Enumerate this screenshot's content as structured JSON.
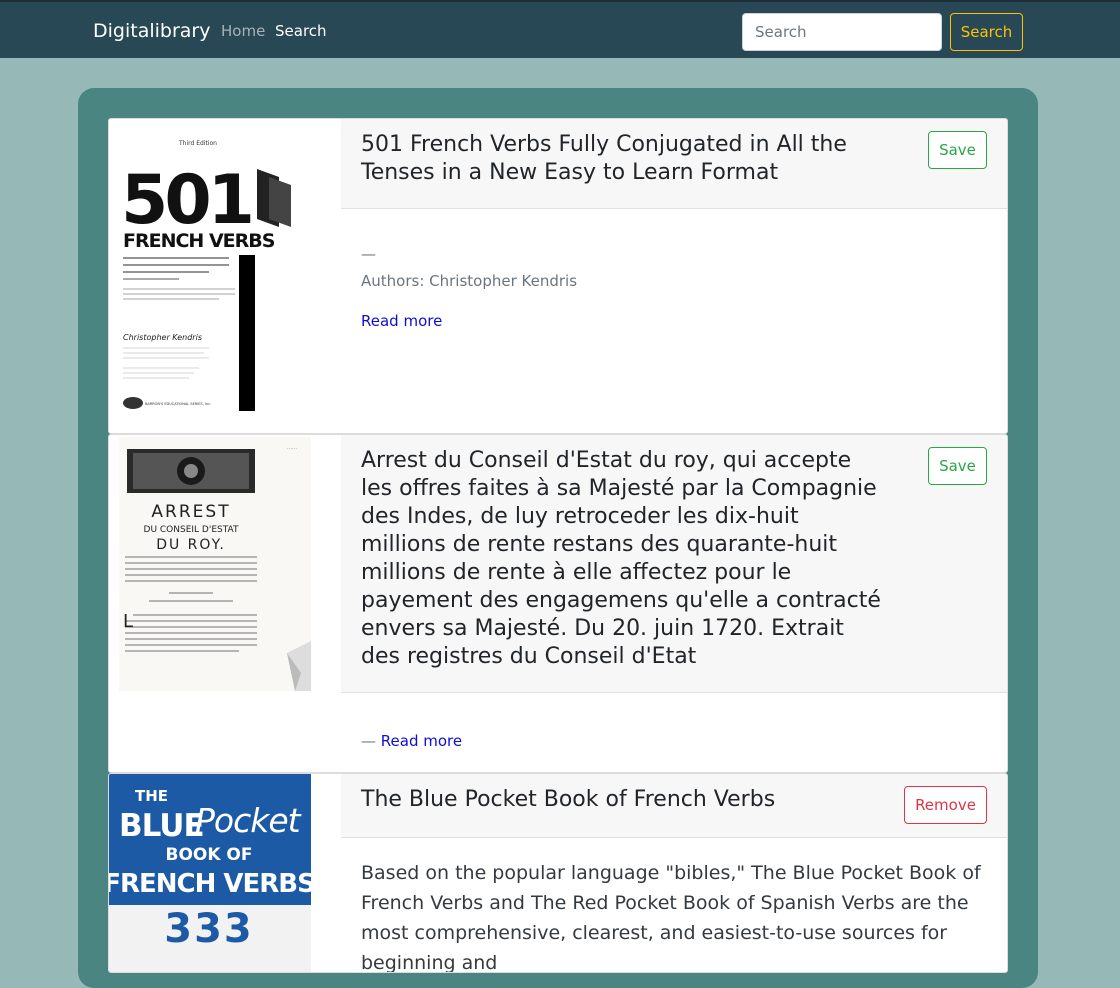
{
  "navbar": {
    "brand": "Digitalibrary",
    "links": {
      "home": "Home",
      "search": "Search"
    },
    "search_placeholder": "Search",
    "search_button": "Search"
  },
  "results": [
    {
      "title": "501 French Verbs Fully Conjugated in All the Tenses in a New Easy to Learn Format",
      "dash": "—",
      "authors": "Authors: Christopher Kendris",
      "read_more": "Read more",
      "action": "Save",
      "cover": {
        "edition": "Third Edition",
        "number": "501",
        "title": "FRENCH VERBS",
        "tagline": "fully conjugated in all the tenses in a new easy to learn format",
        "author": "Christopher Kendris",
        "publisher": "BARRON'S EDUCATIONAL SERIES, Inc."
      }
    },
    {
      "title": "Arrest du Conseil d'Estat du roy, qui accepte les offres faites à sa Majesté par la Compagnie des Indes, de luy retroceder les dix-huit millions de rente restans des quarante-huit millions de rente à elle affectez pour le payement des engagemens qu'elle a contracté envers sa Majesté. Du 20. juin 1720. Extrait des registres du Conseil d'Etat",
      "dash": "—",
      "read_more": "Read more",
      "action": "Save",
      "cover": {
        "line1": "ARREST",
        "line2": "DU CONSEIL D'ESTAT",
        "line3": "DU ROY."
      }
    },
    {
      "title": "The Blue Pocket Book of French Verbs",
      "description": "Based on the popular language \"bibles,\" The Blue Pocket Book of French Verbs and The Red Pocket Book of Spanish Verbs are the most comprehensive, clearest, and easiest-to-use sources for beginning and",
      "action": "Remove",
      "cover": {
        "the": "THE",
        "blue": "BLUE",
        "pocket": "Pocket",
        "book_of": "BOOK OF",
        "french_verbs": "FRENCH VERBS",
        "number": "333"
      }
    }
  ],
  "colors": {
    "navbar": "#274854",
    "page_bg": "#96b9b8",
    "panel": "#4a8582",
    "save": "#28a745",
    "remove": "#dc3545",
    "search_button": "#ffc107",
    "cover_blue": "#1d5aa6"
  }
}
